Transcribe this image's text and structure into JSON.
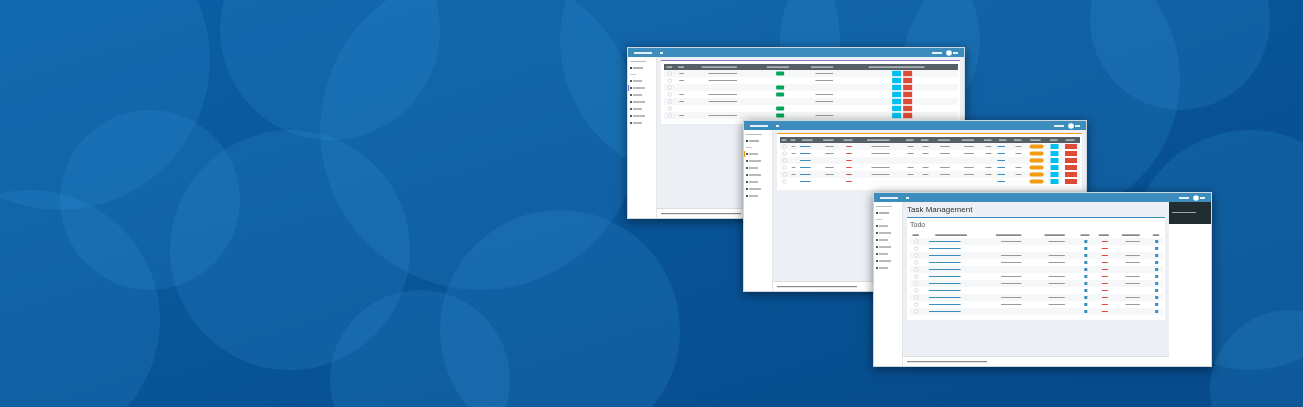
{
  "windows": [
    {
      "kind": "posts"
    },
    {
      "kind": "users"
    },
    {
      "kind": "tasks",
      "page_title": "Task Management",
      "card_title": "Todo"
    }
  ]
}
